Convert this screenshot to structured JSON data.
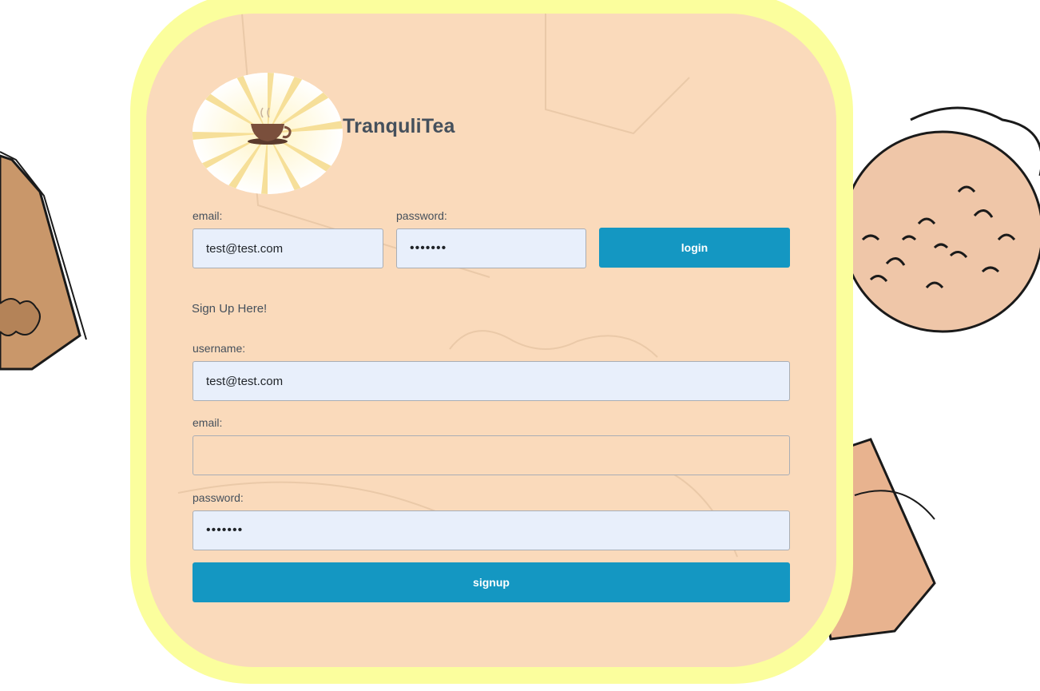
{
  "app": {
    "brand_name": "TranquliTea"
  },
  "login": {
    "email_label": "email:",
    "email_value": "test@test.com",
    "password_label": "password:",
    "password_value": "•••••••",
    "login_button": "login"
  },
  "signup": {
    "heading": "Sign Up Here!",
    "username_label": "username:",
    "username_value": "test@test.com",
    "email_label": "email:",
    "email_value": "",
    "password_label": "password:",
    "password_value": "•••••••",
    "signup_button": "signup"
  },
  "colors": {
    "outer_border": "#fbfe9d",
    "card_background": "#fadabb",
    "accent_button": "#1497c2",
    "input_background": "#e8effb",
    "text": "#45505c"
  },
  "icons": [
    "tea-bag-illustration",
    "tea-cup-logo"
  ]
}
